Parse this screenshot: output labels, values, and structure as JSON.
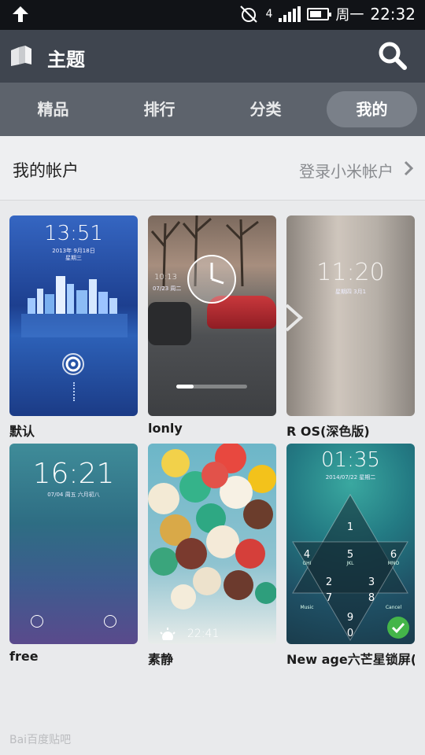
{
  "status": {
    "day": "周一",
    "time": "22:32",
    "network": "4"
  },
  "header": {
    "title": "主题"
  },
  "tabs": [
    {
      "label": "精品"
    },
    {
      "label": "排行"
    },
    {
      "label": "分类"
    },
    {
      "label": "我的",
      "active": true
    }
  ],
  "account": {
    "label": "我的帐户",
    "login": "登录小米帐户"
  },
  "themes": [
    {
      "name": "默认",
      "clock": "13:51",
      "date": "2013年 9月18日",
      "weekday": "星期三"
    },
    {
      "name": "lonly",
      "clock": "10:13",
      "date": "07/23 周二"
    },
    {
      "name": "R OS(深色版)",
      "clock": "11:20",
      "date": "星期四 3月1"
    },
    {
      "name": "free",
      "clock": "16:21",
      "date": "07/04 周五 六月初八"
    },
    {
      "name": "素静",
      "clock": "22:41"
    },
    {
      "name": "New age六芒星锁屏(...",
      "clock": "01:35",
      "date": "2014/07/22 星期二",
      "applied": true
    }
  ],
  "watermark": "Bai百度贴吧"
}
